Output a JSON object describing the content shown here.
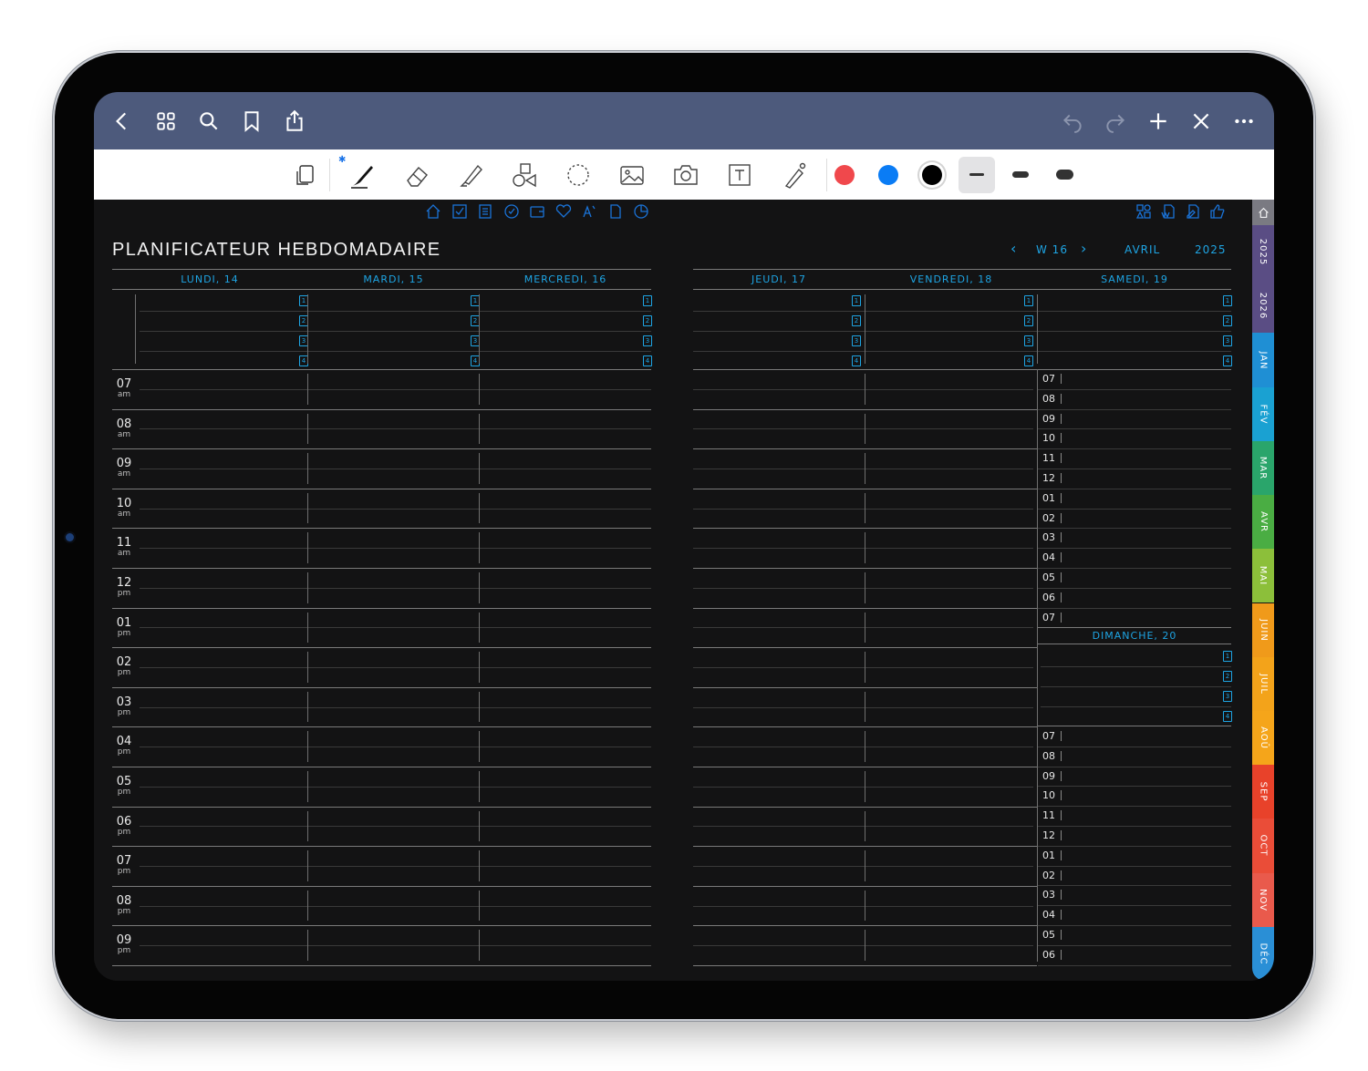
{
  "nav": {
    "left_icons": [
      "back-chevron-icon",
      "grid-icon",
      "search-icon",
      "bookmark-icon",
      "share-icon"
    ],
    "right_icons": [
      "undo-icon",
      "redo-icon",
      "plus-icon",
      "close-pen-icon",
      "more-icon"
    ]
  },
  "toolbar": {
    "tools": [
      "read-mode-icon",
      "pen-icon",
      "eraser-icon",
      "highlighter-icon",
      "shapes-icon",
      "lasso-icon",
      "image-icon",
      "camera-icon",
      "text-icon",
      "laser-pointer-icon"
    ],
    "colors": [
      "#f0484c",
      "#0a7cf5",
      "#000000"
    ],
    "stroke_widths": [
      "thin",
      "medium",
      "thick"
    ]
  },
  "planner": {
    "title": "PLANIFICATEUR HEBDOMADAIRE",
    "week_prev": "‹",
    "week": "W 16",
    "week_next": "›",
    "month": "AVRIL",
    "year": "2025",
    "left_days": [
      "LUNDI, 14",
      "MARDI, 15",
      "MERCREDI, 16"
    ],
    "right_days": [
      "JEUDI, 17",
      "VENDREDI, 18",
      "SAMEDI, 19"
    ],
    "sunday": "DIMANCHE, 20",
    "priorities": [
      "1",
      "2",
      "3",
      "4"
    ],
    "hours": [
      {
        "h": "07",
        "p": "am"
      },
      {
        "h": "08",
        "p": "am"
      },
      {
        "h": "09",
        "p": "am"
      },
      {
        "h": "10",
        "p": "am"
      },
      {
        "h": "11",
        "p": "am"
      },
      {
        "h": "12",
        "p": "pm"
      },
      {
        "h": "01",
        "p": "pm"
      },
      {
        "h": "02",
        "p": "pm"
      },
      {
        "h": "03",
        "p": "pm"
      },
      {
        "h": "04",
        "p": "pm"
      },
      {
        "h": "05",
        "p": "pm"
      },
      {
        "h": "06",
        "p": "pm"
      },
      {
        "h": "07",
        "p": "pm"
      },
      {
        "h": "08",
        "p": "pm"
      },
      {
        "h": "09",
        "p": "pm"
      }
    ],
    "weekend_hours": [
      "07",
      "08",
      "09",
      "10",
      "11",
      "12",
      "01",
      "02",
      "03",
      "04",
      "05",
      "06",
      "07"
    ],
    "sunday_hours": [
      "07",
      "08",
      "09",
      "10",
      "11",
      "12",
      "01",
      "02",
      "03",
      "04",
      "05",
      "06"
    ]
  },
  "top_left_icons": [
    "home-icon",
    "checkbox-icon",
    "notes-icon",
    "habit-icon",
    "wallet-icon",
    "heart-icon",
    "fitness-icon",
    "document-icon",
    "pie-chart-icon"
  ],
  "top_right_icons": [
    "dashboard-icon",
    "week-doc-icon",
    "edit-doc-icon",
    "thumbs-up-icon"
  ],
  "side_tabs": [
    {
      "label": "2025",
      "color": "#5a4d84"
    },
    {
      "label": "2026",
      "color": "#5a4d84"
    },
    {
      "label": "JAN",
      "color": "#1f8fd4"
    },
    {
      "label": "FÉV",
      "color": "#1aa1d2"
    },
    {
      "label": "MAR",
      "color": "#2aa56b"
    },
    {
      "label": "AVR",
      "color": "#4aad43"
    },
    {
      "label": "MAI",
      "color": "#8cbf3a"
    },
    {
      "label": "JUIN",
      "color": "#f09a1a"
    },
    {
      "label": "JUIL",
      "color": "#f3a31a"
    },
    {
      "label": "AOÛ",
      "color": "#f5a51a"
    },
    {
      "label": "SEP",
      "color": "#e8422a"
    },
    {
      "label": "OCT",
      "color": "#ea4d38"
    },
    {
      "label": "NOV",
      "color": "#e95a4c"
    },
    {
      "label": "DÉC",
      "color": "#2a8fd6"
    }
  ]
}
